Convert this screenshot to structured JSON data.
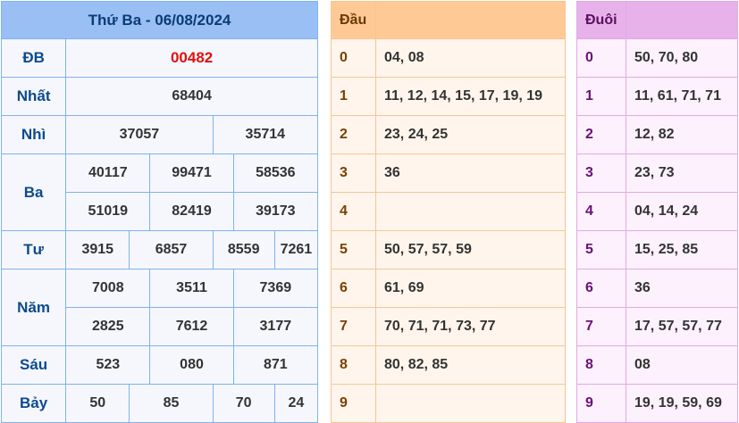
{
  "results": {
    "title": "Thứ Ba - 06/08/2024",
    "db": {
      "label": "ĐB",
      "values": [
        "00482"
      ]
    },
    "nhat": {
      "label": "Nhất",
      "values": [
        "68404"
      ]
    },
    "nhi": {
      "label": "Nhì",
      "values": [
        "37057",
        "35714"
      ]
    },
    "ba": {
      "label": "Ba",
      "values": [
        "40117",
        "99471",
        "58536",
        "51019",
        "82419",
        "39173"
      ]
    },
    "tu": {
      "label": "Tư",
      "values": [
        "3915",
        "6857",
        "8559",
        "7261"
      ]
    },
    "nam": {
      "label": "Năm",
      "values": [
        "7008",
        "3511",
        "7369",
        "2825",
        "7612",
        "3177"
      ]
    },
    "sau": {
      "label": "Sáu",
      "values": [
        "523",
        "080",
        "871"
      ]
    },
    "bay": {
      "label": "Bảy",
      "values": [
        "50",
        "85",
        "70",
        "24"
      ]
    }
  },
  "dau": {
    "title": "Đầu",
    "rows": [
      {
        "digit": "0",
        "values": "04, 08"
      },
      {
        "digit": "1",
        "values": "11, 12, 14, 15, 17, 19, 19"
      },
      {
        "digit": "2",
        "values": "23, 24, 25"
      },
      {
        "digit": "3",
        "values": "36"
      },
      {
        "digit": "4",
        "values": ""
      },
      {
        "digit": "5",
        "values": "50, 57, 57, 59"
      },
      {
        "digit": "6",
        "values": "61, 69"
      },
      {
        "digit": "7",
        "values": "70, 71, 71, 73, 77"
      },
      {
        "digit": "8",
        "values": "80, 82, 85"
      },
      {
        "digit": "9",
        "values": ""
      }
    ]
  },
  "duoi": {
    "title": "Đuôi",
    "rows": [
      {
        "digit": "0",
        "values": "50, 70, 80"
      },
      {
        "digit": "1",
        "values": "11, 61, 71, 71"
      },
      {
        "digit": "2",
        "values": "12, 82"
      },
      {
        "digit": "3",
        "values": "23, 73"
      },
      {
        "digit": "4",
        "values": "04, 14, 24"
      },
      {
        "digit": "5",
        "values": "15, 25, 85"
      },
      {
        "digit": "6",
        "values": "36"
      },
      {
        "digit": "7",
        "values": "17, 57, 57, 77"
      },
      {
        "digit": "8",
        "values": "08"
      },
      {
        "digit": "9",
        "values": "19, 19, 59, 69"
      }
    ]
  },
  "colors": {
    "results_header": "#99bff5",
    "special_prize": "#e01010",
    "dau_header": "#ffc995",
    "duoi_header": "#e7b2ea"
  }
}
